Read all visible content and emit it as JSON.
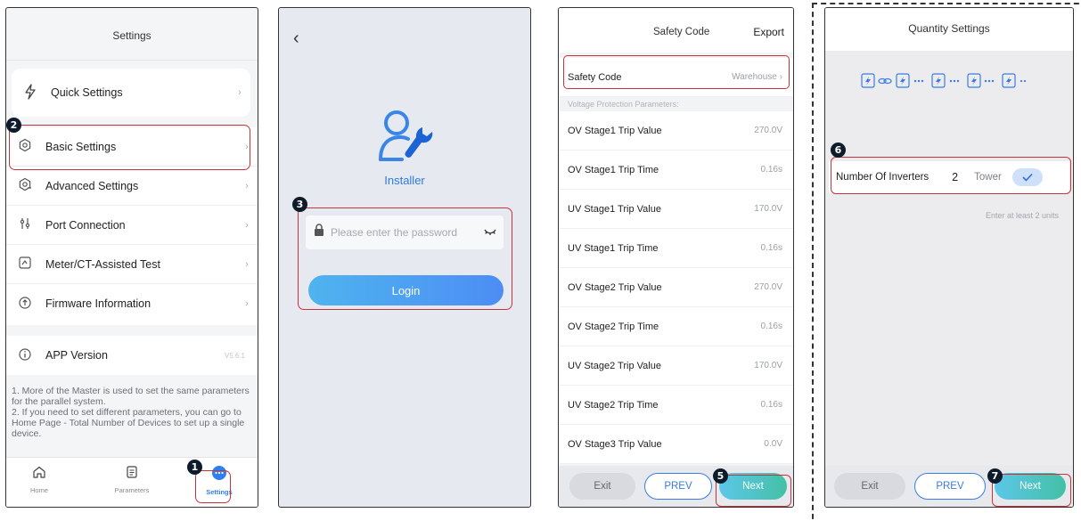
{
  "screen1": {
    "title": "Settings",
    "items": [
      {
        "label": "Quick Settings",
        "icon": "lightning-icon"
      },
      {
        "label": "Basic Settings",
        "icon": "gear-icon"
      },
      {
        "label": "Advanced Settings",
        "icon": "advanced-gear-icon"
      },
      {
        "label": "Port Connection",
        "icon": "port-icon"
      },
      {
        "label": "Meter/CT-Assisted Test",
        "icon": "meter-icon"
      },
      {
        "label": "Firmware Information",
        "icon": "firmware-icon"
      }
    ],
    "app_version_label": "APP Version",
    "app_version_value": "V5.6.1",
    "note": "1. More of the Master is used to set the same parameters for the parallel system.\n2. If you need to set different parameters, you can go to Home Page - Total Number of Devices to set up a single device.",
    "tabs": [
      {
        "label": "Home",
        "icon": "home-icon"
      },
      {
        "label": "Parameters",
        "icon": "document-icon"
      },
      {
        "label": "Settings",
        "icon": "more-icon"
      }
    ],
    "badges": {
      "basic": "2",
      "settings": "1"
    }
  },
  "screen2": {
    "back": "‹",
    "role": "Installer",
    "password_placeholder": "Please enter the password",
    "login_label": "Login",
    "badge": "3"
  },
  "screen3": {
    "title": "Safety Code",
    "export_label": "Export",
    "safety_code_label": "Safety Code",
    "safety_code_value": "Warehouse",
    "section_header": "Voltage Protection Parameters:",
    "params": [
      {
        "label": "OV Stage1 Trip Value",
        "value": "270.0V"
      },
      {
        "label": "OV Stage1 Trip Time",
        "value": "0.16s"
      },
      {
        "label": "UV Stage1 Trip Value",
        "value": "170.0V"
      },
      {
        "label": "UV Stage1 Trip Time",
        "value": "0.16s"
      },
      {
        "label": "OV Stage2 Trip Value",
        "value": "270.0V"
      },
      {
        "label": "OV Stage2 Trip Time",
        "value": "0.16s"
      },
      {
        "label": "UV Stage2 Trip Value",
        "value": "170.0V"
      },
      {
        "label": "UV Stage2 Trip Time",
        "value": "0.16s"
      },
      {
        "label": "OV Stage3 Trip Value",
        "value": "0.0V"
      }
    ],
    "exit_label": "Exit",
    "prev_label": "PREV",
    "next_label": "Next",
    "badge": "5"
  },
  "screen4": {
    "title": "Quantity Settings",
    "inverters_label": "Number Of Inverters",
    "inverters_value": "2",
    "tower_label": "Tower",
    "hint": "Enter at least 2 units",
    "exit_label": "Exit",
    "prev_label": "PREV",
    "next_label": "Next",
    "badges": {
      "inverters": "6",
      "next": "7"
    }
  },
  "colors": {
    "accent": "#3b7be0",
    "highlight": "#c7333a",
    "badge": "#0d1b2a"
  }
}
